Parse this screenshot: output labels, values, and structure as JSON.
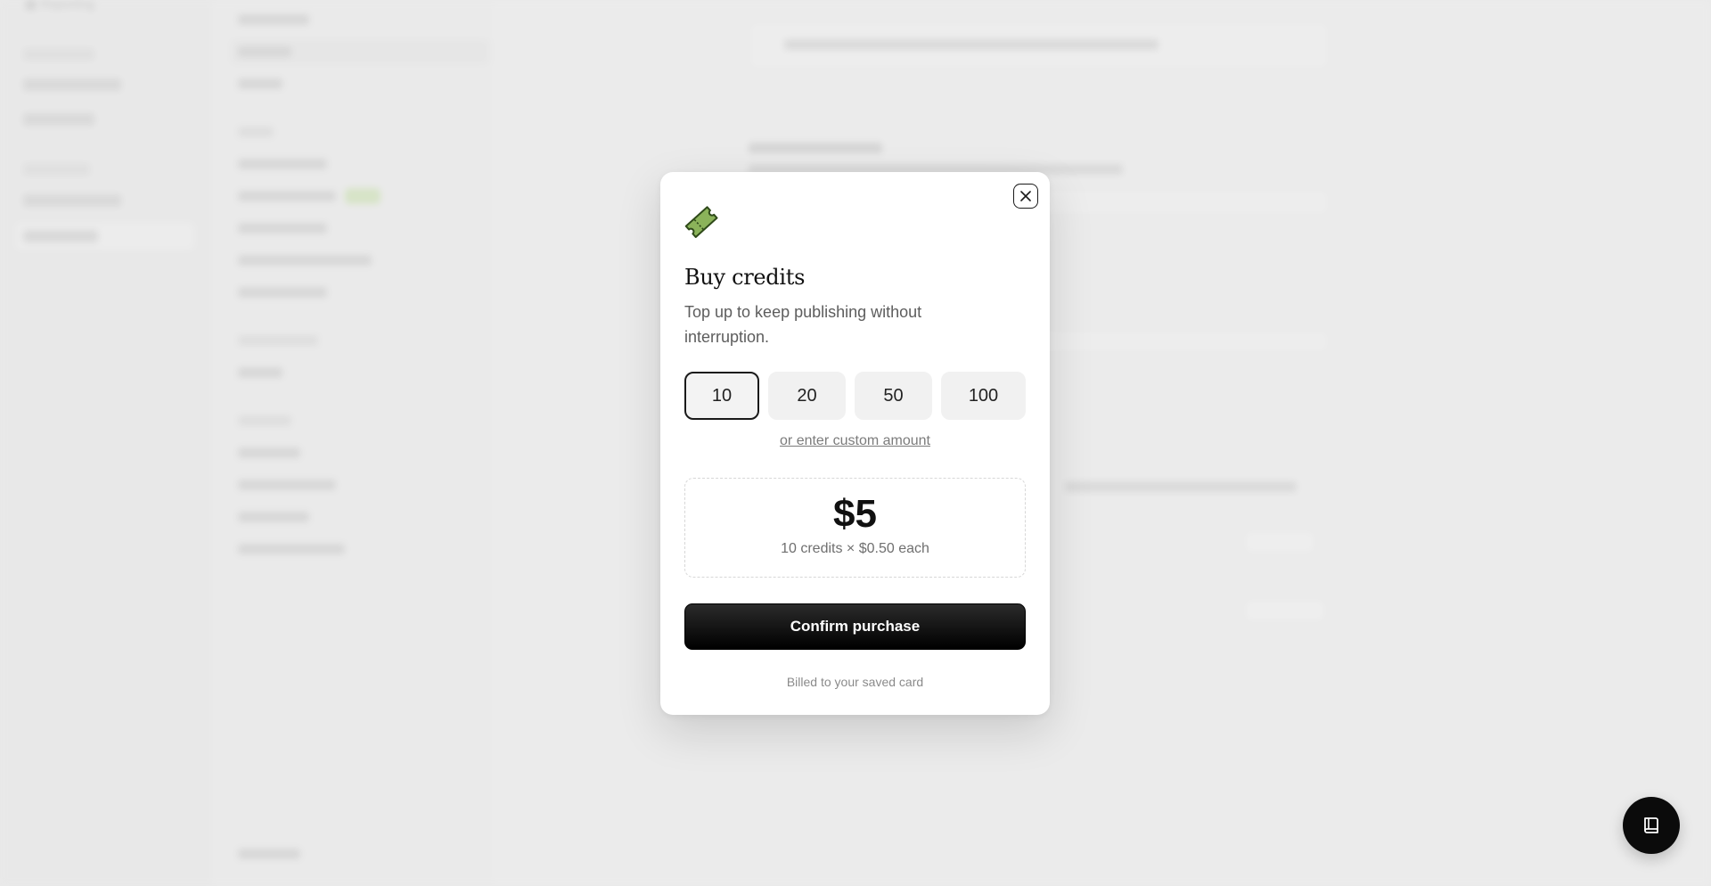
{
  "background": {
    "rail_items": [
      "Reporting"
    ]
  },
  "modal": {
    "title": "Buy credits",
    "subtitle": "Top up to keep publishing without interruption.",
    "amount_options": [
      {
        "label": "10",
        "selected": true
      },
      {
        "label": "20",
        "selected": false
      },
      {
        "label": "50",
        "selected": false
      },
      {
        "label": "100",
        "selected": false
      }
    ],
    "custom_amount_link": "or enter custom amount",
    "summary": {
      "price": "$5",
      "detail": "10 credits × $0.50 each"
    },
    "confirm_label": "Confirm purchase",
    "billing_note": "Billed to your saved card",
    "icons": {
      "logo": "ticket-icon",
      "close": "close-icon"
    },
    "accent_color": "#8bb35a"
  },
  "fab": {
    "icon": "book-icon"
  }
}
